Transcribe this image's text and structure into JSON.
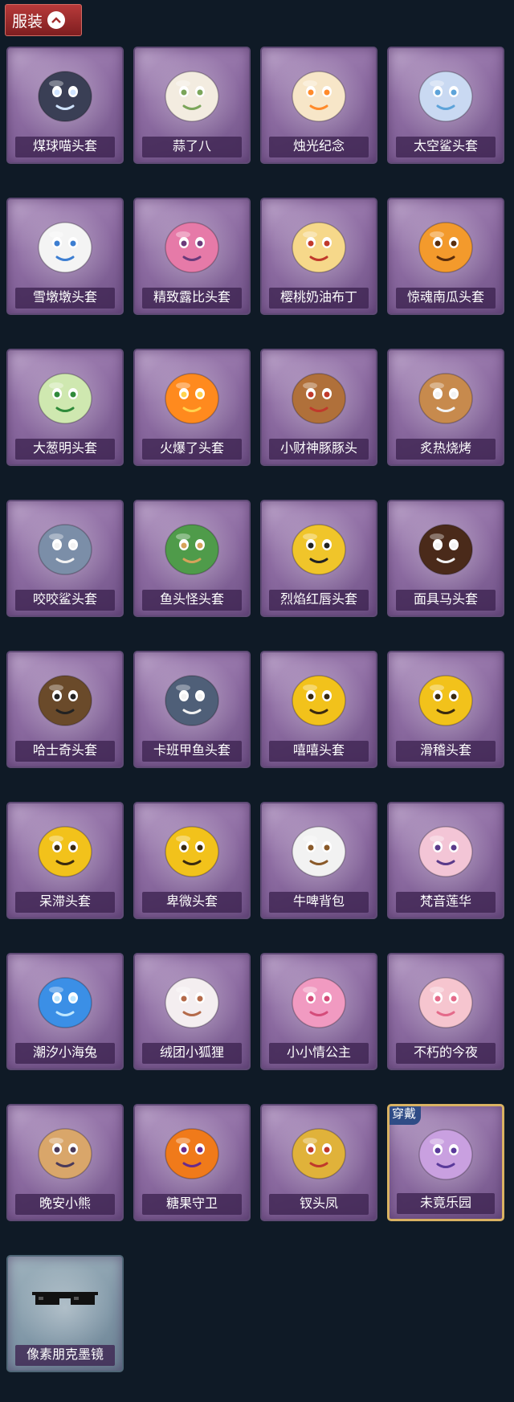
{
  "header": {
    "label": "服装",
    "icon": "chevron-up-icon"
  },
  "colors": {
    "header": "#a22d2d",
    "worn_border": "#d9b262",
    "worn_badge": "#2f4c86"
  },
  "items": [
    {
      "name": "煤球喵头套",
      "icon": "cat-head-icon"
    },
    {
      "name": "蒜了八",
      "icon": "garlic-head-icon"
    },
    {
      "name": "烛光纪念",
      "icon": "candle-head-icon"
    },
    {
      "name": "太空鲨头套",
      "icon": "space-shark-head-icon"
    },
    {
      "name": "雪墩墩头套",
      "icon": "snowman-head-icon"
    },
    {
      "name": "精致露比头套",
      "icon": "beaver-head-icon"
    },
    {
      "name": "樱桃奶油布丁",
      "icon": "pudding-head-icon"
    },
    {
      "name": "惊魂南瓜头套",
      "icon": "pumpkin-head-icon"
    },
    {
      "name": "大葱明头套",
      "icon": "scallion-head-icon"
    },
    {
      "name": "火爆了头套",
      "icon": "fire-head-icon"
    },
    {
      "name": "小财神豚豚头",
      "icon": "capybara-head-icon"
    },
    {
      "name": "炙热烧烤",
      "icon": "bbq-head-icon"
    },
    {
      "name": "咬咬鲨头套",
      "icon": "shark-head-icon"
    },
    {
      "name": "鱼头怪头套",
      "icon": "fish-head-icon"
    },
    {
      "name": "烈焰红唇头套",
      "icon": "pikachu-head-icon"
    },
    {
      "name": "面具马头套",
      "icon": "horse-head-icon"
    },
    {
      "name": "哈士奇头套",
      "icon": "husky-head-icon"
    },
    {
      "name": "卡班甲鱼头套",
      "icon": "whale-head-icon"
    },
    {
      "name": "嘻嘻头套",
      "icon": "grin-emoji-icon"
    },
    {
      "name": "滑稽头套",
      "icon": "smile-emoji-icon"
    },
    {
      "name": "呆滞头套",
      "icon": "stare-emoji-icon"
    },
    {
      "name": "卑微头套",
      "icon": "humble-emoji-icon"
    },
    {
      "name": "牛啤背包",
      "icon": "cow-beer-backpack-icon"
    },
    {
      "name": "梵音莲华",
      "icon": "lotus-doll-icon"
    },
    {
      "name": "潮汐小海兔",
      "icon": "sea-bunny-icon"
    },
    {
      "name": "绒团小狐狸",
      "icon": "fox-plush-icon"
    },
    {
      "name": "小小情公主",
      "icon": "princess-doll-icon"
    },
    {
      "name": "不朽的今夜",
      "icon": "cake-fox-icon"
    },
    {
      "name": "晚安小熊",
      "icon": "bear-charm-icon"
    },
    {
      "name": "糖果守卫",
      "icon": "pumpkin-scarecrow-icon"
    },
    {
      "name": "钗头凤",
      "icon": "phoenix-crown-icon"
    },
    {
      "name": "未竟乐园",
      "icon": "purple-doll-icon",
      "badge": "穿戴"
    },
    {
      "name": "像素朋克墨镜",
      "icon": "pixel-sunglasses-icon"
    }
  ]
}
